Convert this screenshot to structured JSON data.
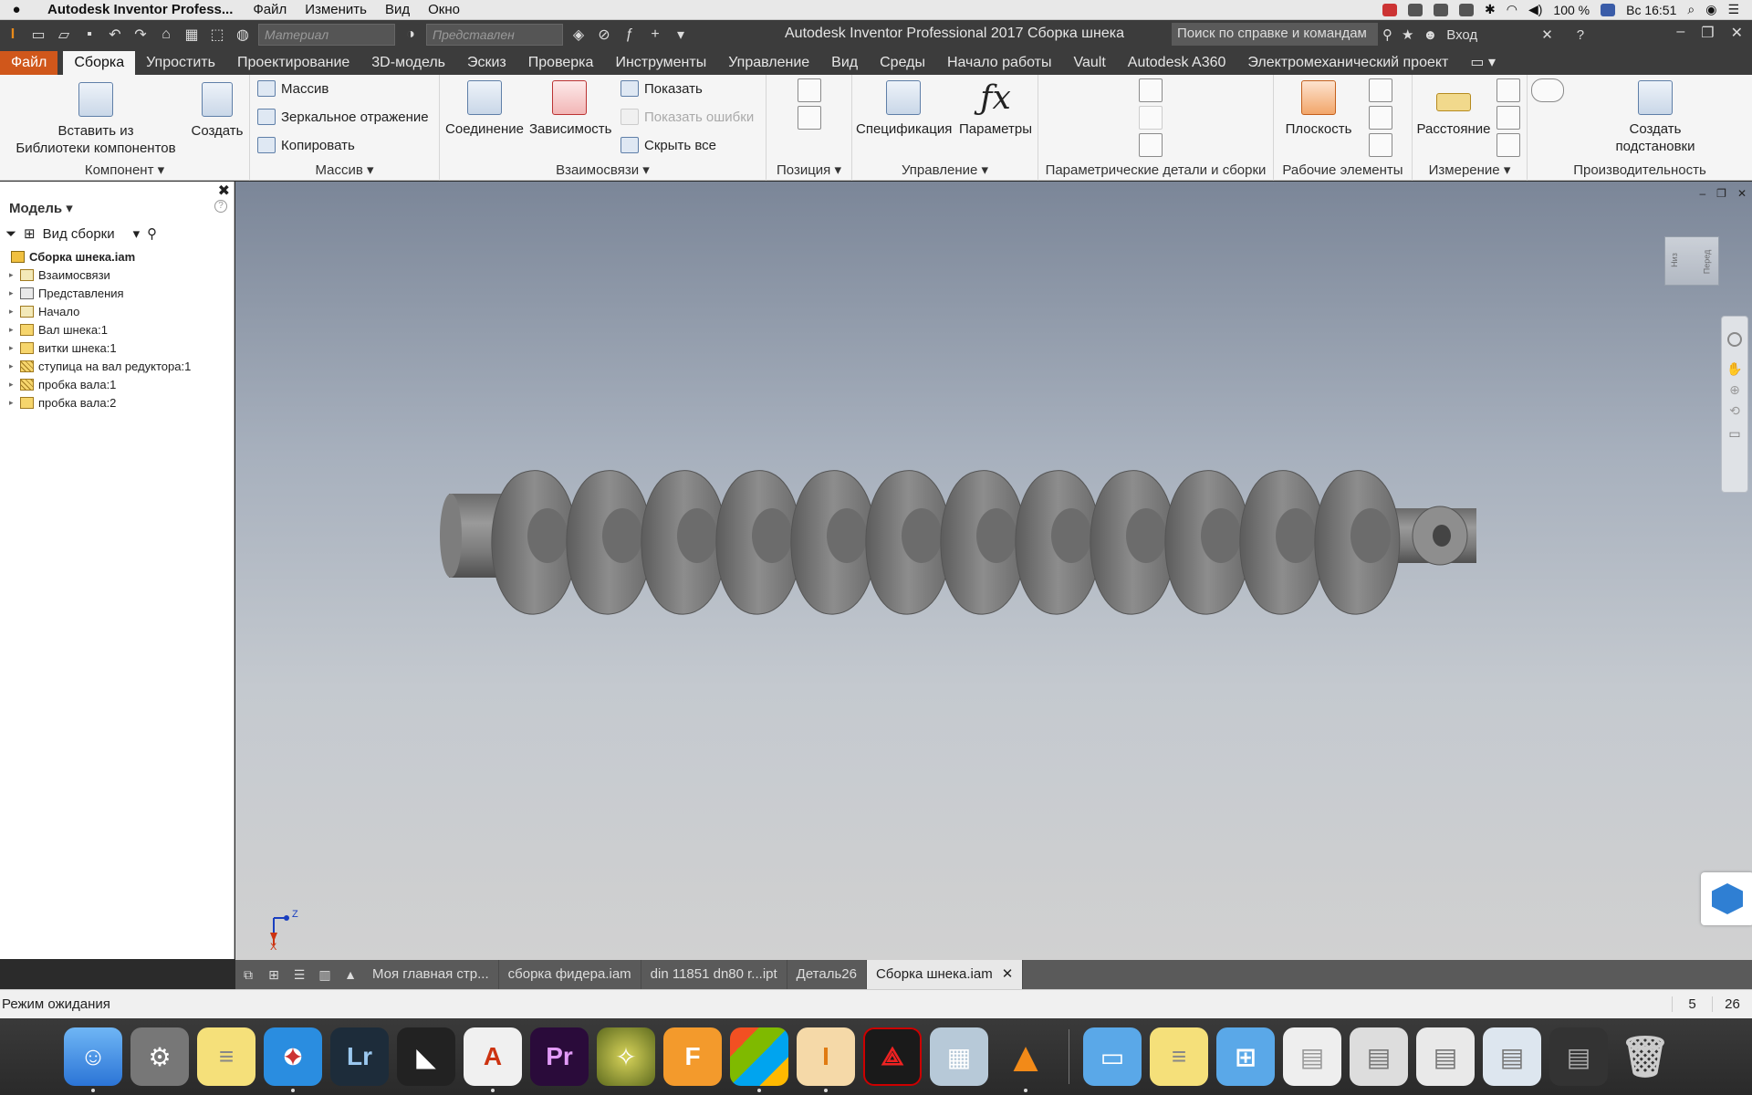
{
  "menubar": {
    "app_name": "Autodesk Inventor Profess...",
    "items": [
      "Файл",
      "Изменить",
      "Вид",
      "Окно"
    ],
    "battery": "100 %",
    "clock": "Вс 16:51"
  },
  "qat": {
    "material_placeholder": "Материал",
    "appearance_placeholder": "Представлен",
    "title": "Autodesk Inventor Professional 2017     Сборка шнека",
    "search_placeholder": "Поиск по справке и командам",
    "signin": "Вход"
  },
  "tabs": [
    "Файл",
    "Сборка",
    "Упростить",
    "Проектирование",
    "3D-модель",
    "Эскиз",
    "Проверка",
    "Инструменты",
    "Управление",
    "Вид",
    "Среды",
    "Начало работы",
    "Vault",
    "Autodesk A360",
    "Электромеханический проект"
  ],
  "ribbon": {
    "component": {
      "insert_label": "Вставить из\nБиблиотеки компонентов",
      "create_label": "Создать",
      "panel": "Компонент"
    },
    "pattern": {
      "massiv": "Массив",
      "mirror": "Зеркальное отражение",
      "copy": "Копировать",
      "panel": "Массив"
    },
    "relations": {
      "joint": "Соединение",
      "constraint": "Зависимость",
      "show": "Показать",
      "show_errors": "Показать ошибки",
      "hide_all": "Скрыть все",
      "panel": "Взаимосвязи"
    },
    "position": {
      "panel": "Позиция"
    },
    "manage": {
      "bom": "Спецификация",
      "params": "Параметры",
      "panel": "Управление"
    },
    "parametric": {
      "panel": "Параметрические детали и сборки"
    },
    "work": {
      "plane": "Плоскость",
      "panel": "Рабочие элементы"
    },
    "measure": {
      "distance": "Расстояние",
      "panel": "Измерение"
    },
    "productivity": {
      "create_sub": "Создать\nподстановки",
      "panel": "Производительность"
    }
  },
  "browser": {
    "title": "Модель",
    "view": "Вид сборки",
    "root": "Сборка шнека.iam",
    "items": [
      "Взаимосвязи",
      "Представления",
      "Начало",
      "Вал шнека:1",
      "витки шнека:1",
      "ступица на вал редуктора:1",
      "пробка вала:1",
      "пробка вала:2"
    ]
  },
  "viewcube": {
    "left": "Низ",
    "right": "Перед"
  },
  "triad": {
    "z": "Z",
    "x": "X"
  },
  "doctabs": {
    "items": [
      "Моя главная стр...",
      "сборка фидера.iam",
      "din 11851 dn80 r...ipt",
      "Деталь26"
    ],
    "active": "Сборка шнека.iam"
  },
  "status": {
    "text": "Режим ожидания",
    "n1": "5",
    "n2": "26"
  },
  "dock": {
    "apps": [
      "Finder",
      "System Preferences",
      "Notes",
      "Safari",
      "Lr",
      "Git",
      "AutoCAD",
      "Pr",
      "Fusion",
      "F 360",
      "Windows",
      "Inventor",
      "Acrobat",
      "Preview",
      "VLC"
    ]
  },
  "colors": {
    "accent": "#d0571b",
    "ribbon": "#f5f5f5",
    "dark": "#3c3c3c"
  }
}
